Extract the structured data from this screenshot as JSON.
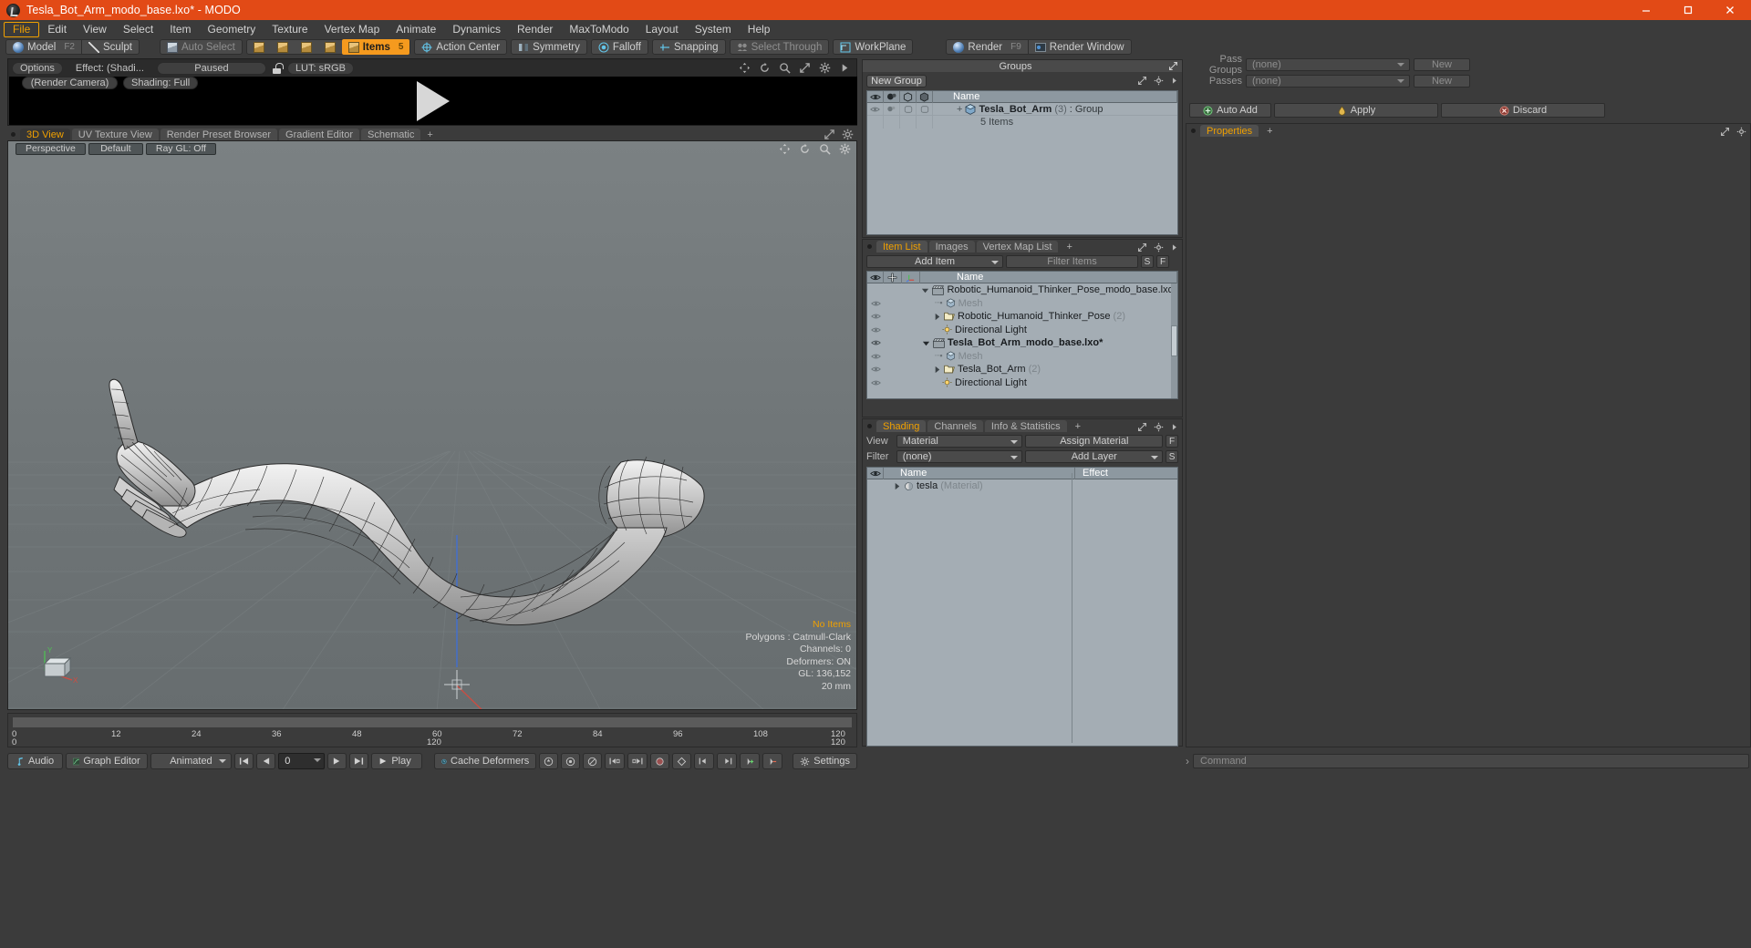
{
  "titlebar": {
    "title": "Tesla_Bot_Arm_modo_base.lxo* - MODO",
    "minimize": "–",
    "maximize": "□",
    "close": "✕"
  },
  "menubar": {
    "items": [
      {
        "label": "File",
        "active": true
      },
      {
        "label": "Edit",
        "active": false
      },
      {
        "label": "View",
        "active": false
      },
      {
        "label": "Select",
        "active": false
      },
      {
        "label": "Item",
        "active": false
      },
      {
        "label": "Geometry",
        "active": false
      },
      {
        "label": "Texture",
        "active": false
      },
      {
        "label": "Vertex Map",
        "active": false
      },
      {
        "label": "Animate",
        "active": false
      },
      {
        "label": "Dynamics",
        "active": false
      },
      {
        "label": "Render",
        "active": false
      },
      {
        "label": "MaxToModo",
        "active": false
      },
      {
        "label": "Layout",
        "active": false
      },
      {
        "label": "System",
        "active": false
      },
      {
        "label": "Help",
        "active": false
      }
    ]
  },
  "toolbar": {
    "model": "Model",
    "model_hotkey": "F2",
    "sculpt": "Sculpt",
    "auto_select": "Auto Select",
    "items": "Items",
    "items_hotkey": "5",
    "action_center": "Action Center",
    "symmetry": "Symmetry",
    "falloff": "Falloff",
    "snapping": "Snapping",
    "select_through": "Select Through",
    "workplane": "WorkPlane",
    "render": "Render",
    "render_hotkey": "F9",
    "render_window": "Render Window"
  },
  "preview": {
    "options": "Options",
    "effect": "Effect: (Shadi...",
    "status": "Paused",
    "lut": "LUT: sRGB",
    "render_camera": "(Render Camera)",
    "shading": "Shading: Full"
  },
  "view_tabs": {
    "tabs": [
      {
        "label": "3D View",
        "active": true
      },
      {
        "label": "UV Texture View",
        "active": false
      },
      {
        "label": "Render Preset Browser",
        "active": false
      },
      {
        "label": "Gradient Editor",
        "active": false
      },
      {
        "label": "Schematic",
        "active": false
      }
    ],
    "add": "+"
  },
  "viewport": {
    "perspective": "Perspective",
    "default": "Default",
    "raygl": "Ray GL: Off",
    "stats": {
      "items": "No Items",
      "polygons": "Polygons : Catmull-Clark",
      "channels": "Channels: 0",
      "deformers": "Deformers: ON",
      "gl": "GL: 136,152",
      "scale": "20 mm"
    },
    "axis": {
      "y": "Y",
      "x": "X"
    }
  },
  "timeline": {
    "ticks": [
      "0",
      "12",
      "24",
      "36",
      "48",
      "60",
      "72",
      "84",
      "96",
      "108",
      "120"
    ],
    "range_start": "0",
    "range_mid": "120",
    "range_end": "120"
  },
  "bottombar": {
    "audio": "Audio",
    "graph_editor": "Graph Editor",
    "animated": "Animated",
    "frame_value": "0",
    "play": "Play",
    "cache_deformers": "Cache Deformers",
    "settings": "Settings"
  },
  "groups_panel": {
    "title": "Groups",
    "new_group": "New Group",
    "columns": [
      "eye",
      "shade",
      "cube1",
      "cube2",
      "Name"
    ],
    "name_header": "Name",
    "rows": [
      {
        "name": "Tesla_Bot_Arm",
        "count": "(3)",
        "type": ": Group",
        "sub": "5 Items"
      }
    ]
  },
  "item_list_panel": {
    "tabs": [
      {
        "label": "Item List",
        "active": true
      },
      {
        "label": "Images",
        "active": false
      },
      {
        "label": "Vertex Map List",
        "active": false
      }
    ],
    "add_tab": "+",
    "add_item": "Add Item",
    "filter_items": "Filter Items",
    "btn_s": "S",
    "btn_f": "F",
    "name_header": "Name",
    "rows": [
      {
        "indent": 0,
        "label": "Robotic_Humanoid_Thinker_Pose_modo_base.lxo*",
        "suffix": "",
        "kind": "scene",
        "bold": false,
        "eye": false,
        "arrow": "down"
      },
      {
        "indent": 1,
        "label": "Mesh",
        "suffix": "",
        "kind": "mesh",
        "bold": false,
        "eye": true,
        "arrow": "none",
        "muted": true
      },
      {
        "indent": 1,
        "label": "Robotic_Humanoid_Thinker_Pose",
        "suffix": "(2)",
        "kind": "folder",
        "bold": false,
        "eye": true,
        "arrow": "right"
      },
      {
        "indent": 1,
        "label": "Directional Light",
        "suffix": "",
        "kind": "light",
        "bold": false,
        "eye": true,
        "arrow": "none"
      },
      {
        "indent": 0,
        "label": "Tesla_Bot_Arm_modo_base.lxo*",
        "suffix": "",
        "kind": "scene",
        "bold": true,
        "eye": true,
        "arrow": "down"
      },
      {
        "indent": 1,
        "label": "Mesh",
        "suffix": "",
        "kind": "mesh",
        "bold": false,
        "eye": true,
        "arrow": "none",
        "muted": true
      },
      {
        "indent": 1,
        "label": "Tesla_Bot_Arm",
        "suffix": "(2)",
        "kind": "folder",
        "bold": false,
        "eye": true,
        "arrow": "right"
      },
      {
        "indent": 1,
        "label": "Directional Light",
        "suffix": "",
        "kind": "light",
        "bold": false,
        "eye": true,
        "arrow": "none"
      }
    ]
  },
  "shading_panel": {
    "tabs": [
      {
        "label": "Shading",
        "active": true
      },
      {
        "label": "Channels",
        "active": false
      },
      {
        "label": "Info & Statistics",
        "active": false
      }
    ],
    "add_tab": "+",
    "view_label": "View",
    "view_value": "Material",
    "assign_material": "Assign Material",
    "btn_f": "F",
    "filter_label": "Filter",
    "filter_value": "(none)",
    "add_layer": "Add Layer",
    "btn_s": "S",
    "col_name": "Name",
    "col_effect": "Effect",
    "rows": [
      {
        "name": "tesla",
        "type": "(Material)"
      }
    ]
  },
  "right_column": {
    "pass_groups_label": "Pass Groups",
    "pass_groups_value": "(none)",
    "passes_label": "Passes",
    "passes_value": "(none)",
    "new_1": "New",
    "new_2": "New",
    "auto_add": "Auto Add",
    "apply": "Apply",
    "discard": "Discard",
    "properties_tab": "Properties",
    "properties_add": "+"
  },
  "command_bar": {
    "placeholder": "Command",
    "arrow": "›"
  },
  "colors": {
    "accent_orange": "#f0a000",
    "title_orange": "#e24a16",
    "panel_bg": "#3b3b3b",
    "grid_bg": "#a4adb4",
    "viewport_bg": "#6e7476"
  }
}
